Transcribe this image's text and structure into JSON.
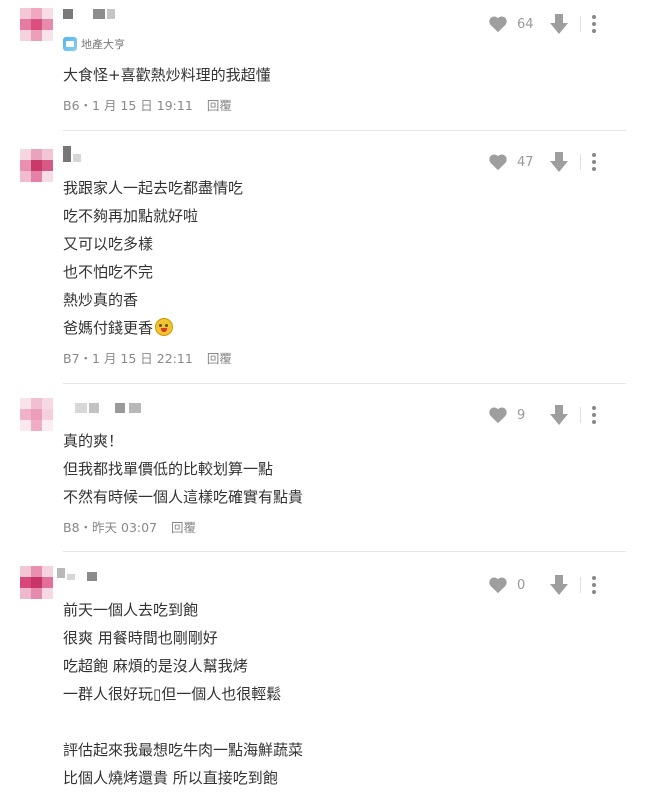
{
  "comments": [
    {
      "floor_meta": "B6・1 月 15 日 19:11",
      "reply": "回覆",
      "likes": "64",
      "badge": "地產大亨",
      "lines": [
        "大食怪+喜歡熱炒料理的我超懂"
      ]
    },
    {
      "floor_meta": "B7・1 月 15 日 22:11",
      "reply": "回覆",
      "likes": "47",
      "lines": [
        "我跟家人一起去吃都盡情吃",
        "吃不夠再加點就好啦",
        "又可以吃多樣",
        "也不怕吃不完",
        "熱炒真的香",
        "爸媽付錢更香"
      ]
    },
    {
      "floor_meta": "B8・昨天 03:07",
      "reply": "回覆",
      "likes": "9",
      "lines": [
        "真的爽！",
        "但我都找單價低的比較划算一點",
        "不然有時候一個人這樣吃確實有點貴"
      ]
    },
    {
      "floor_meta": "",
      "reply": "",
      "likes": "0",
      "lines": [
        "前天一個人去吃到飽",
        "很爽 用餐時間也剛剛好",
        "吃超飽 麻煩的是沒人幫我烤",
        "一群人很好玩▯但一個人也很輕鬆",
        "",
        "評估起來我最想吃牛肉一點海鮮蔬菜",
        "比個人燒烤還貴 所以直接吃到飽"
      ]
    }
  ],
  "icons": {
    "like": "heart-icon",
    "downvote": "arrow-down-icon",
    "more": "more-vertical-icon",
    "emoji": "smile-emoji-icon",
    "badge": "badge-icon"
  },
  "colors": {
    "icon": "#9e9e9e",
    "text": "#333333",
    "meta": "#888888"
  }
}
